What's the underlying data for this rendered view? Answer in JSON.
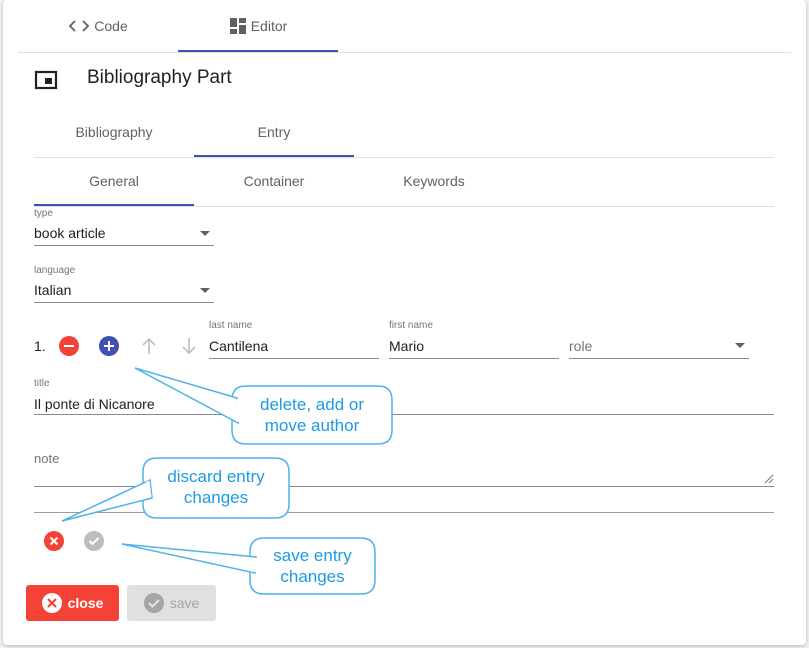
{
  "top_tabs": {
    "code": "Code",
    "editor": "Editor"
  },
  "part": {
    "title": "Bibliography Part"
  },
  "tabs": {
    "bibliography": "Bibliography",
    "entry": "Entry"
  },
  "subtabs": {
    "general": "General",
    "container": "Container",
    "keywords": "Keywords"
  },
  "form": {
    "type_label": "type",
    "type_value": "book article",
    "language_label": "language",
    "language_value": "Italian",
    "author": {
      "index": "1.",
      "last_name_label": "last name",
      "last_name_value": "Cantilena",
      "first_name_label": "first name",
      "first_name_value": "Mario",
      "role_placeholder": "role"
    },
    "title_label": "title",
    "title_value": "Il ponte di Nicanore",
    "note_label": "note",
    "note_value": ""
  },
  "buttons": {
    "close": "close",
    "save": "save"
  },
  "callouts": {
    "author": [
      "delete, add or",
      "move author"
    ],
    "discard": [
      "discard entry",
      "changes"
    ],
    "save": [
      "save entry",
      "changes"
    ]
  },
  "colors": {
    "accent": "#3f51b5",
    "danger": "#f44336",
    "callout_text": "#1e9be0",
    "callout_border": "#4fb3e8"
  }
}
